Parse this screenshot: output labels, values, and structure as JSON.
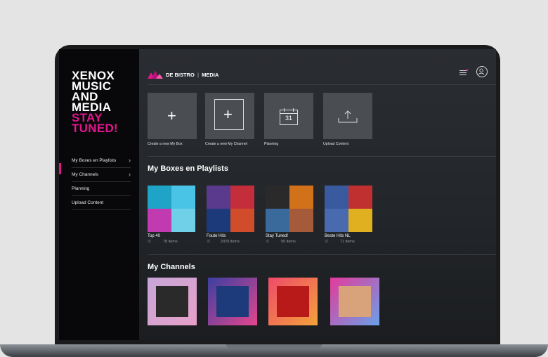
{
  "sidebar": {
    "brand_lines": [
      "XENOX",
      "MUSIC",
      "AND",
      "MEDIA"
    ],
    "brand_accent_lines": [
      "STAY",
      "TUNED!"
    ],
    "nav": [
      {
        "label": "My Boxes en Playlists",
        "chevron": true
      },
      {
        "label": "My Channels",
        "chevron": true
      },
      {
        "label": "Planning",
        "chevron": false
      },
      {
        "label": "Upload Content",
        "chevron": false
      }
    ],
    "chevron_glyph": "›"
  },
  "header": {
    "title_left": "DE BISTRO",
    "title_sep": "|",
    "title_right": "MEDIA"
  },
  "actions": [
    {
      "label": "Create a new My Box",
      "icon": "plus-icon"
    },
    {
      "label": "Create a new My Channel",
      "icon": "plus-box-icon"
    },
    {
      "label": "Planning",
      "icon": "calendar-icon",
      "calendar_day": "31"
    },
    {
      "label": "Upload Content",
      "icon": "upload-icon"
    }
  ],
  "boxes_section": {
    "title": "My Boxes en Playlists"
  },
  "boxes": [
    {
      "name": "Top 40",
      "count": "78 items",
      "colors": [
        "#1fa3c7",
        "#49c3e6",
        "#c23ab0",
        "#6fd0e8"
      ]
    },
    {
      "name": "Foute Hits",
      "count": "2029 items",
      "colors": [
        "#5a3a8c",
        "#c42e3a",
        "#1c3a7a",
        "#d04c2a"
      ]
    },
    {
      "name": "Stay Tuned!",
      "count": "50 items",
      "colors": [
        "#2a2a2a",
        "#d1711a",
        "#3a6a9c",
        "#a55a3a"
      ]
    },
    {
      "name": "Beste Hits NL",
      "count": "71 items",
      "colors": [
        "#3a5aa0",
        "#c03030",
        "#4a6ab0",
        "#e0b020"
      ]
    }
  ],
  "channels_section": {
    "title": "My Channels"
  },
  "channels": [
    {
      "frame": [
        "#c6a6d8",
        "#e7a0c8"
      ],
      "inner": "#2a2a2a"
    },
    {
      "frame": [
        "#3b3fa0",
        "#e4468e"
      ],
      "inner": "#1d3b7a"
    },
    {
      "frame": [
        "#f04a6a",
        "#f2a23a"
      ],
      "inner": "#b81a1a"
    },
    {
      "frame": [
        "#e43a9a",
        "#6aa0e8"
      ],
      "inner": "#d8a27a"
    }
  ],
  "colors": {
    "accent": "#e1168d"
  }
}
